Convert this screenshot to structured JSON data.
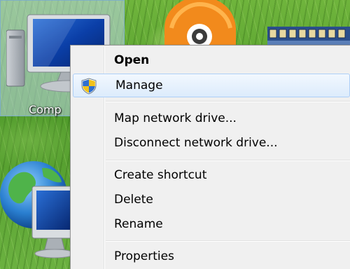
{
  "desktop": {
    "computer_label": "Comp"
  },
  "context_menu": {
    "items": [
      {
        "label": "Open",
        "default": true
      },
      {
        "label": "Manage",
        "icon": "uac-shield-icon",
        "highlighted": true
      },
      {
        "label": "Map network drive..."
      },
      {
        "label": "Disconnect network drive..."
      },
      {
        "label": "Create shortcut"
      },
      {
        "label": "Delete"
      },
      {
        "label": "Rename"
      },
      {
        "label": "Properties"
      }
    ]
  },
  "colors": {
    "menu_background": "#f0f0f0",
    "highlight_border": "#aecff7",
    "highlight_fill": "#dcebfc",
    "desktop_green": "#5fa032"
  }
}
